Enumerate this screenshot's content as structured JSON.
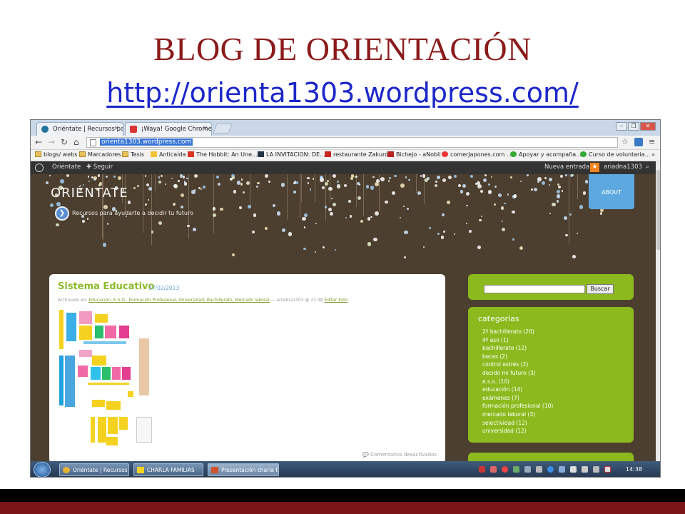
{
  "slide": {
    "title": "BLOG DE ORIENTACIÓN",
    "link": "http://orienta1303.wordpress.com/"
  },
  "browser": {
    "tabs": [
      {
        "label": "Oriéntate | Recursos para",
        "close": "×"
      },
      {
        "label": "¡Waya! Google Chrome no",
        "close": "×"
      }
    ],
    "url": "orienta1303.wordpress.com",
    "bookmarks": [
      "blogs/ webs",
      "Marcadores",
      "Tesis",
      "Anticaída",
      "The Hobbit: An Une...",
      "LA INVITACION: DE...",
      "restaurante Zakuro",
      "Bichejo - aNobii",
      "comerJapones.com ...",
      "Apoyar y acompaña...",
      "Curso de voluntaria..."
    ],
    "bookmarks_more": "»"
  },
  "wpbar": {
    "site": "Oriéntate",
    "follow": "Seguir",
    "new_post": "Nueva entrada",
    "user": "ariadna1303"
  },
  "site": {
    "logo": "ORIÉNTATE",
    "tagline": "Recursos para ayudarte a decidir tu futuro",
    "about": "ABOUT"
  },
  "post": {
    "title": "Sistema Educativo",
    "date": "17/02/2013",
    "meta_prefix": "Archivado en:",
    "categories": "Educación, E.S.O., Formación Profesional, Universidad, Bachillerato, Mercado laboral",
    "meta_suffix": "— ariadna1303 @ 21:38",
    "edit": "Editar Esto",
    "comments": "Comentarios desactivados"
  },
  "sidebar": {
    "search_button": "Buscar",
    "categories_title": "categorías",
    "categories": [
      "2º bachillerato (20)",
      "4º eso (1)",
      "bachillerato (12)",
      "becas (2)",
      "control estrés (2)",
      "decido mi futuro (3)",
      "e.s.o. (10)",
      "educación (14)",
      "exámenes (7)",
      "formación profesional (10)",
      "mercado laboral (3)",
      "selectividad (12)",
      "universidad (12)"
    ]
  },
  "taskbar": {
    "tasks": [
      "Oriéntate | Recursos ...",
      "CHARLA FAMILIAS",
      "Presentación charla f..."
    ],
    "clock": "14:38"
  }
}
